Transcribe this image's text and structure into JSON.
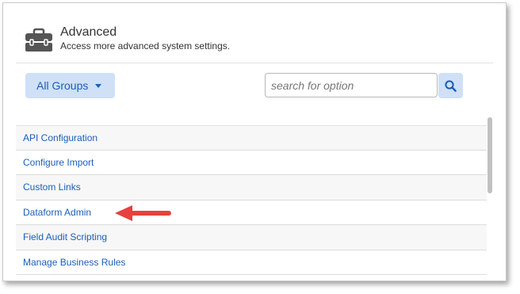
{
  "header": {
    "title": "Advanced",
    "subtitle": "Access more advanced system settings.",
    "icon": "toolbox-icon"
  },
  "filter": {
    "group_label": "All Groups",
    "search_placeholder": "search for option"
  },
  "options": [
    {
      "label": "API Configuration"
    },
    {
      "label": "Configure Import"
    },
    {
      "label": "Custom Links"
    },
    {
      "label": "Dataform Admin"
    },
    {
      "label": "Field Audit Scripting"
    },
    {
      "label": "Manage Business Rules"
    }
  ],
  "colors": {
    "accent": "#1b5fb8",
    "button_bg": "#cfe0f7",
    "annotation_arrow": "#e8403e"
  }
}
